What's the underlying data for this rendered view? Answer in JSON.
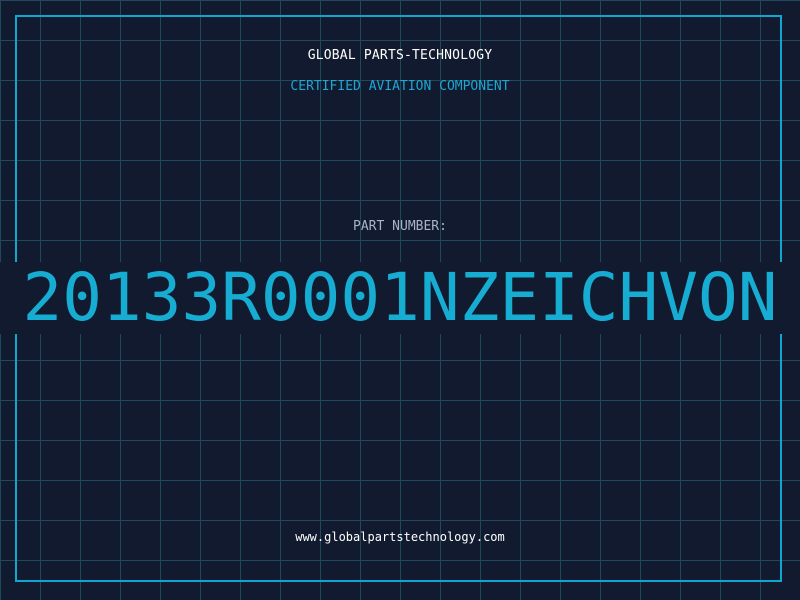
{
  "header": {
    "title": "GLOBAL PARTS-TECHNOLOGY",
    "subtitle": "CERTIFIED AVIATION COMPONENT"
  },
  "part": {
    "label": "PART NUMBER:",
    "number": "20133R0001NZEICHVON"
  },
  "footer": {
    "url": "www.globalpartstechnology.com"
  },
  "colors": {
    "background": "#111a2e",
    "grid": "#1f4a5e",
    "accent": "#17acd2",
    "label": "#a9b4c4",
    "text": "#ffffff"
  }
}
